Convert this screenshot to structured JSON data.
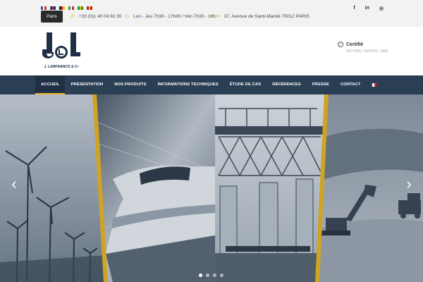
{
  "topbar": {
    "languages": [
      {
        "code": "fr",
        "colors": [
          "#2b4ea8",
          "#ffffff",
          "#d72b2b"
        ]
      },
      {
        "code": "en",
        "colors": [
          "#203a80",
          "#c8202a",
          "#203a80"
        ]
      },
      {
        "code": "de",
        "colors": [
          "#222222",
          "#d72b2b",
          "#f2c200"
        ]
      },
      {
        "code": "it",
        "colors": [
          "#2a9a48",
          "#ffffff",
          "#d72b2b"
        ]
      },
      {
        "code": "br",
        "colors": [
          "#1f9a3a",
          "#f2c200",
          "#1f9a3a"
        ]
      },
      {
        "code": "es",
        "colors": [
          "#c8202a",
          "#f2c200",
          "#c8202a"
        ]
      }
    ],
    "city": "Paris",
    "phone": "+33 (0)1 40 04 92 30",
    "hours": "Lun - Jeu 7h30 - 17h30 / Ven 7h30 - 16h",
    "address": "37, Avenue de Saint-Mandé 75012 PARIS",
    "phone_icon": "phone-icon",
    "clock_icon": "clock-icon",
    "location_icon": "location-icon",
    "socials": [
      {
        "name": "facebook-icon",
        "glyph": "f"
      },
      {
        "name": "linkedin-icon",
        "glyph": "in"
      },
      {
        "name": "instagram-icon",
        "glyph": "◎"
      }
    ]
  },
  "header": {
    "logo_text": "J. LANFRANCO & Cᵉ",
    "certified_title": "Certifié",
    "certified_sub": "ISO 9001 DEPUIS 1988"
  },
  "nav": {
    "items": [
      "ACCUEIL",
      "PRÉSENTATION",
      "NOS PRODUITS",
      "INFORMATIONS TECHNIQUES",
      "ÉTUDE DE CAS",
      "RÉFÉRENCES",
      "PRESSE",
      "CONTACT"
    ],
    "active_index": 0,
    "lang_flag_colors": [
      "#2b4ea8",
      "#ffffff",
      "#d72b2b"
    ]
  },
  "hero": {
    "prev_label": "‹",
    "next_label": "›",
    "slides_count": 4,
    "active_slide": 0,
    "accent_color": "#e8b420"
  }
}
